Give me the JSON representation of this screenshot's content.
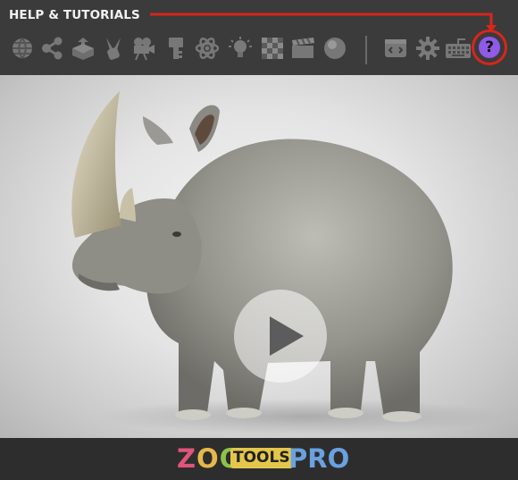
{
  "header": {
    "title": "HELP & TUTORIALS"
  },
  "toolbar": {
    "icons": [
      "globe-icon",
      "share-nodes-icon",
      "box-stack-icon",
      "multi-tool-icon",
      "camera-icon",
      "key-icon",
      "atom-icon",
      "lightbulb-icon",
      "checker-icon",
      "clapperboard-icon",
      "sphere-icon",
      "code-window-icon",
      "gear-icon",
      "keyboard-icon"
    ],
    "help_label": "?"
  },
  "colors": {
    "header_bg": "#3b3b3b",
    "accent_red": "#d7261c",
    "help_purple": "#8f5ae6"
  },
  "footer": {
    "logo_zoo": "ZOO",
    "logo_tools": "TOOLS",
    "logo_pro": "PRO"
  }
}
